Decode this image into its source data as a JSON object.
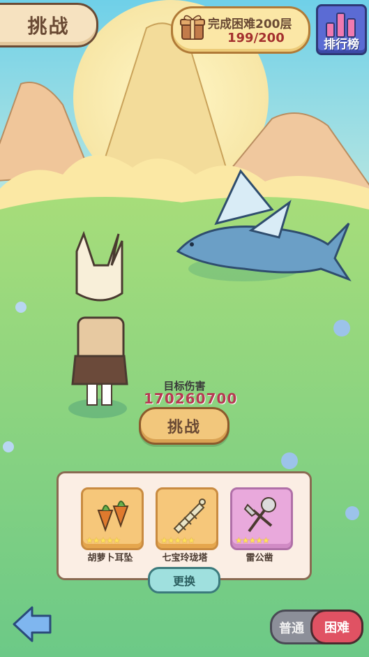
{
  "header": {
    "title": "挑战"
  },
  "quest": {
    "text": "完成困难200层",
    "progress": "199/200"
  },
  "ranking": {
    "label": "排行榜"
  },
  "target": {
    "label": "目标伤害",
    "value": "170260700"
  },
  "challenge_button": {
    "label": "挑战"
  },
  "rewards": {
    "items": [
      {
        "name": "胡萝卜耳坠",
        "stars": 5,
        "icon": "carrot-earring-icon"
      },
      {
        "name": "七宝玲珑塔",
        "stars": 5,
        "icon": "pagoda-icon"
      },
      {
        "name": "雷公凿",
        "stars": 5,
        "icon": "chisel-hammer-icon"
      }
    ],
    "change_label": "更换"
  },
  "mode": {
    "normal_label": "普通",
    "hard_label": "困难",
    "selected": "困难"
  },
  "colors": {
    "accent_gold": "#f2c77c",
    "hard_red": "#e05263",
    "damage_red": "#b63a52"
  }
}
